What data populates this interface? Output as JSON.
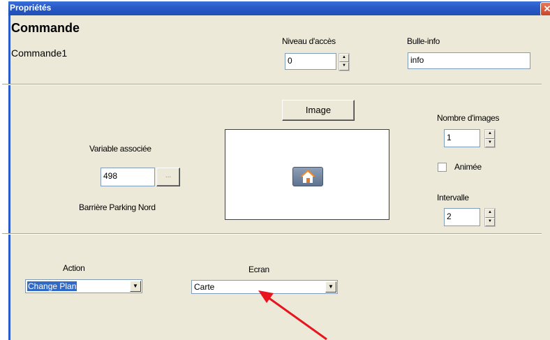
{
  "window": {
    "title": "Propriétés",
    "close_glyph": "✕"
  },
  "header": {
    "control_type": "Commande",
    "control_name": "Commande1",
    "access_level_label": "Niveau d'accès",
    "access_level_value": "0",
    "tooltip_label": "Bulle-info",
    "tooltip_value": "info"
  },
  "middle": {
    "image_button_label": "Image",
    "variable_label": "Variable associée",
    "variable_value": "498",
    "browse_button_label": "...",
    "variable_description": "Barrière Parking Nord",
    "image_count_label": "Nombre d'images",
    "image_count_value": "1",
    "animated_label": "Animée",
    "animated_checked": false,
    "interval_label": "Intervalle",
    "interval_value": "2",
    "preview_icon": "home-icon"
  },
  "bottom": {
    "action_label": "Action",
    "action_value": "Change Plan",
    "screen_label": "Ecran",
    "screen_value": "Carte"
  },
  "colors": {
    "titlebar": "#2a5bc8",
    "dialog": "#ece9d8",
    "annotation_arrow": "#e8141e",
    "selection": "#316ac5"
  }
}
